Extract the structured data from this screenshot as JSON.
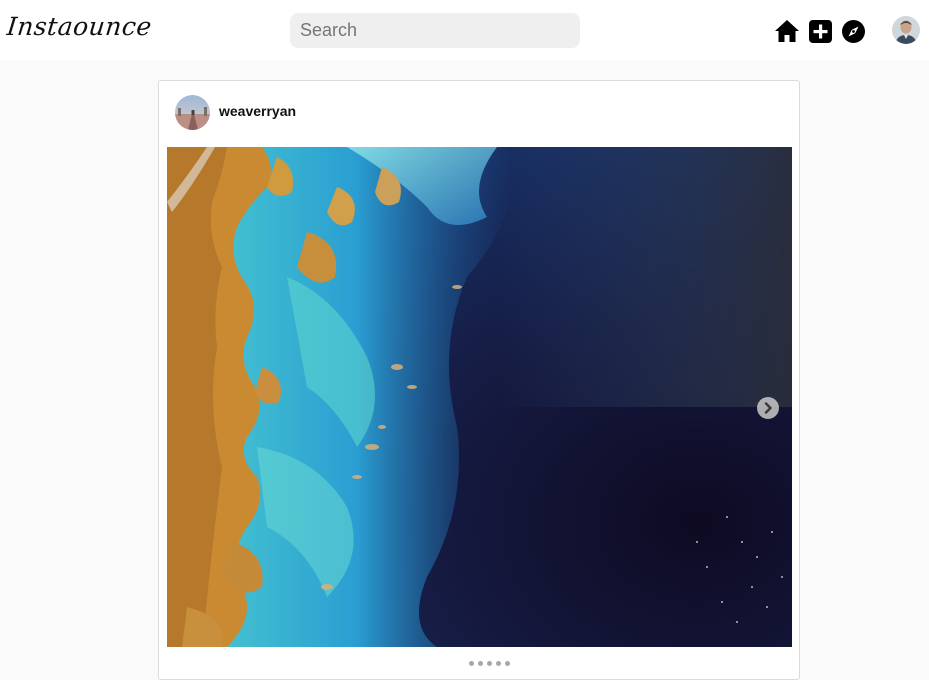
{
  "app": {
    "logo_text": "Instaounce"
  },
  "search": {
    "placeholder": "Search"
  },
  "nav": {
    "icons": [
      "home-icon",
      "new-post-icon",
      "explore-icon"
    ]
  },
  "post": {
    "username": "weaverryan",
    "carousel_slides": 5,
    "active_slide": 1
  }
}
